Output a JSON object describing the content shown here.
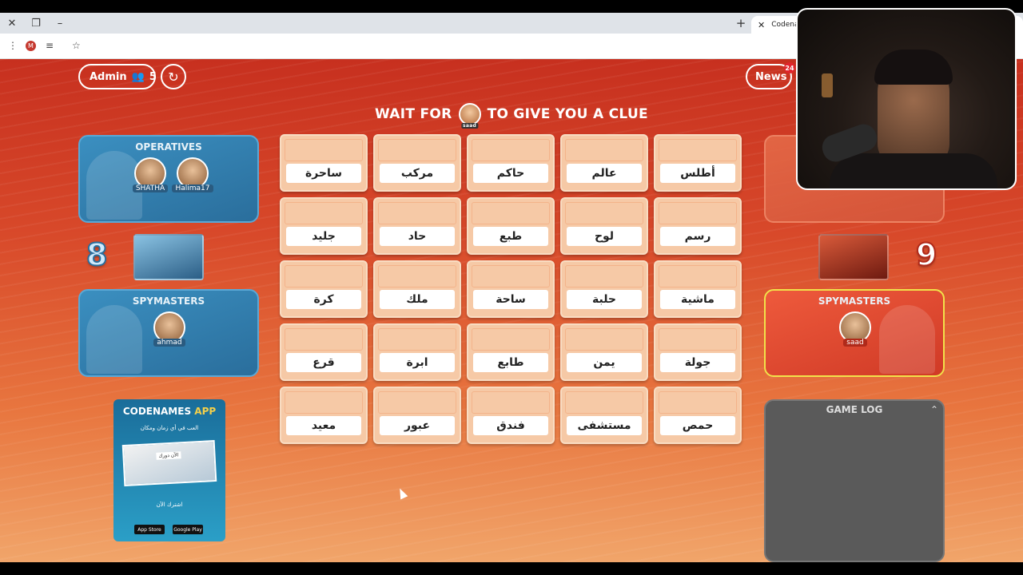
{
  "browser": {
    "tab_title": "Codenam",
    "profile_initial": "M"
  },
  "toolbar": {
    "admin_label": "Admin",
    "players_count": "5",
    "news_label": "News",
    "news_badge": "24"
  },
  "status": {
    "prefix": "WAIT FOR",
    "suffix": "TO GIVE YOU A CLUE",
    "spymaster_tag": "saad"
  },
  "blue_team": {
    "score": "8",
    "operatives_title": "OPERATIVES",
    "operatives": [
      "SHATHA",
      "Halima17"
    ],
    "spymasters_title": "SPYMASTERS",
    "spymasters": [
      "ahmad"
    ]
  },
  "red_team": {
    "score": "9",
    "spymasters_title": "SPYMASTERS",
    "spymasters": [
      "saad"
    ]
  },
  "board": {
    "words": [
      "ساحرة",
      "مركب",
      "حاكم",
      "عالم",
      "أطلس",
      "جليد",
      "حاد",
      "طبع",
      "لوح",
      "رسم",
      "كرة",
      "ملك",
      "ساحة",
      "حلبة",
      "ماشية",
      "قرع",
      "ابرة",
      "طابع",
      "يمن",
      "جولة",
      "معيد",
      "عبور",
      "فندق",
      "مستشفى",
      "حمص"
    ]
  },
  "ad": {
    "title_1": "CODENAMES",
    "title_2": "APP",
    "subtitle": "العب في أي زمان ومكان",
    "image_caption": "الآن دورك",
    "cta": "اشترك الآن",
    "app_store": "App Store",
    "google_play": "Google Play"
  },
  "game_log": {
    "title": "GAME LOG"
  },
  "colors": {
    "blue": "#2a6e9c",
    "red": "#d03a26",
    "card": "#f6c9a6",
    "highlight": "#f1e24a"
  },
  "icons": {
    "players": "people-icon",
    "reset": "refresh-icon",
    "close": "close-icon",
    "new_tab": "plus-icon",
    "chevron": "chevron-up-icon"
  }
}
